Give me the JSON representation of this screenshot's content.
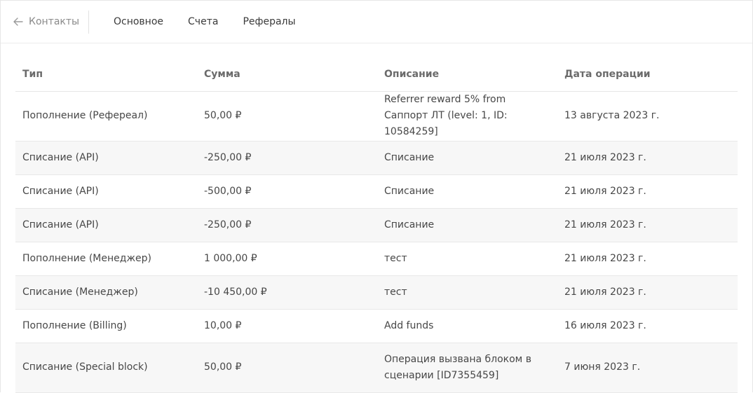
{
  "nav": {
    "back_label": "Контакты",
    "tabs": [
      "Основное",
      "Счета",
      "Рефералы"
    ]
  },
  "table": {
    "headers": [
      "Тип",
      "Сумма",
      "Описание",
      "Дата операции"
    ],
    "rows": [
      {
        "type": "Пополнение (Рефереал)",
        "amount": "50,00 ₽",
        "desc": "Referrer reward 5% from Саппорт ЛТ (level: 1, ID: 10584259]",
        "date": "13 августа 2023 г."
      },
      {
        "type": "Списание (API)",
        "amount": "-250,00 ₽",
        "desc": "Списание",
        "date": "21 июля 2023 г."
      },
      {
        "type": "Списание (API)",
        "amount": "-500,00 ₽",
        "desc": "Списание",
        "date": "21 июля 2023 г."
      },
      {
        "type": "Списание (API)",
        "amount": "-250,00 ₽",
        "desc": "Списание",
        "date": "21 июля 2023 г."
      },
      {
        "type": "Пополнение (Менеджер)",
        "amount": "1 000,00 ₽",
        "desc": "тест",
        "date": "21 июля 2023 г."
      },
      {
        "type": "Списание (Менеджер)",
        "amount": "-10 450,00 ₽",
        "desc": "тест",
        "date": "21 июля 2023 г."
      },
      {
        "type": "Пополнение (Billing)",
        "amount": "10,00 ₽",
        "desc": "Add funds",
        "date": "16 июля 2023 г."
      },
      {
        "type": "Списание (Special block)",
        "amount": "50,00 ₽",
        "desc": "Операция вызвана блоком в сценарии [ID7355459]",
        "date": "7 июня 2023 г."
      }
    ]
  },
  "colors": {
    "stripe": "#f7f7f7",
    "border": "#e8e8e8",
    "muted": "#8a8a8a"
  }
}
